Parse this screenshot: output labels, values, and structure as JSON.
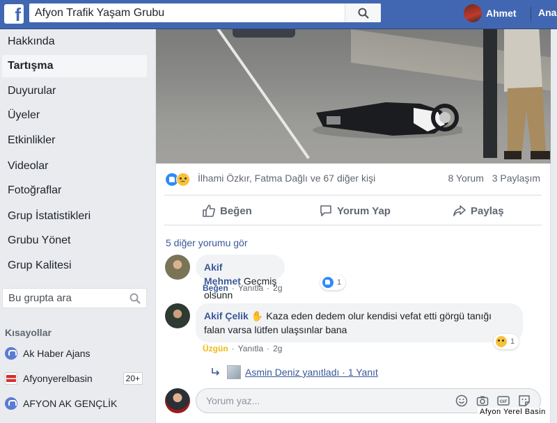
{
  "topbar": {
    "logo": "f",
    "search_value": "Afyon Trafik Yaşam Grubu",
    "user_name": "Ahmet",
    "home_label": "Ana"
  },
  "sidebar": {
    "items": [
      {
        "label": "Hakkında"
      },
      {
        "label": "Tartışma",
        "active": true
      },
      {
        "label": "Duyurular"
      },
      {
        "label": "Üyeler"
      },
      {
        "label": "Etkinlikler"
      },
      {
        "label": "Videolar"
      },
      {
        "label": "Fotoğraflar"
      },
      {
        "label": "Grup İstatistikleri"
      },
      {
        "label": "Grubu Yönet"
      },
      {
        "label": "Grup Kalitesi"
      }
    ],
    "group_search_placeholder": "Bu grupta ara",
    "shortcuts_title": "Kısayollar",
    "shortcuts": [
      {
        "label": "Ak Haber Ajans"
      },
      {
        "label": "Afyonyerelbasin",
        "badge": "20+"
      },
      {
        "label": "AFYON AK GENÇLİK"
      }
    ]
  },
  "post": {
    "reactions": {
      "names": "İlhami Özkır, Fatma Dağlı ve 67 diğer kişi",
      "comments": "8 Yorum",
      "shares": "3 Paylaşım"
    },
    "actions": {
      "like": "Beğen",
      "comment": "Yorum Yap",
      "share": "Paylaş"
    },
    "more_comments": "5 diğer yorumu gör",
    "comments": [
      {
        "author": "Akif Mehmet",
        "text": "Geçmiş olsunn",
        "reaction_label": "Beğen",
        "reply_label": "Yanıtla",
        "time": "2g",
        "reaction_count": "1"
      },
      {
        "author": "Akif Çelik",
        "text": "Kaza eden dedem olur kendisi vefat etti görgü tanığı falan varsa lütfen ulaşsınlar bana",
        "reaction_label": "Üzgün",
        "reply_label": "Yanıtla",
        "time": "2g",
        "reaction_count": "1"
      }
    ],
    "reply_summary": "Asmin Deniz yanıtladı · 1 Yanıt",
    "composer_placeholder": "Yorum yaz..."
  },
  "watermark": "Afyon Yerel Basin",
  "colors": {
    "brand": "#4267b2",
    "link": "#385898",
    "like": "#2e89ff",
    "sad": "#f0ba15"
  }
}
